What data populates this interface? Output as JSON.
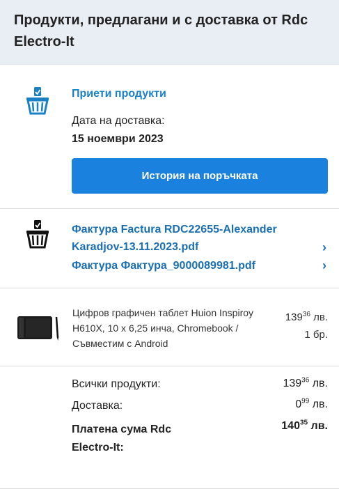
{
  "header": {
    "title": "Продукти, предлагани и с доставка от Rdc Electro-It"
  },
  "accept": {
    "title": "Приети продукти",
    "delivery_label": "Дата на доставка:",
    "delivery_date": "15 ноември 2023",
    "history_button": "История на поръчката"
  },
  "invoices": [
    {
      "label": "Фактура Factura RDC22655-Alexander Karadjov-13.11.2023.pdf"
    },
    {
      "label": "Фактура Фактура_9000089981.pdf"
    }
  ],
  "product": {
    "name": "Цифров графичен таблет Huion Inspiroy H610X, 10 x 6,25 инча, Chromebook / Съвместим с Android",
    "price_main": "139",
    "price_cents": "36",
    "price_currency": "лв.",
    "quantity": "1 бр."
  },
  "totals": {
    "all_label": "Всички продукти:",
    "all_main": "139",
    "all_cents": "36",
    "all_currency": "лв.",
    "delivery_label": "Доставка:",
    "delivery_main": "0",
    "delivery_cents": "99",
    "delivery_currency": "лв.",
    "paid_label": "Платена сума Rdc Electro-It:",
    "paid_main": "140",
    "paid_cents": "35",
    "paid_currency": "лв."
  },
  "icons": {
    "basket_accepted": "basket-check-icon",
    "basket_invoice": "basket-document-icon",
    "chevron": "chevron-right-icon"
  },
  "colors": {
    "accent": "#1a82de",
    "link": "#1a6fb3",
    "header_bg": "#e9eef4"
  }
}
